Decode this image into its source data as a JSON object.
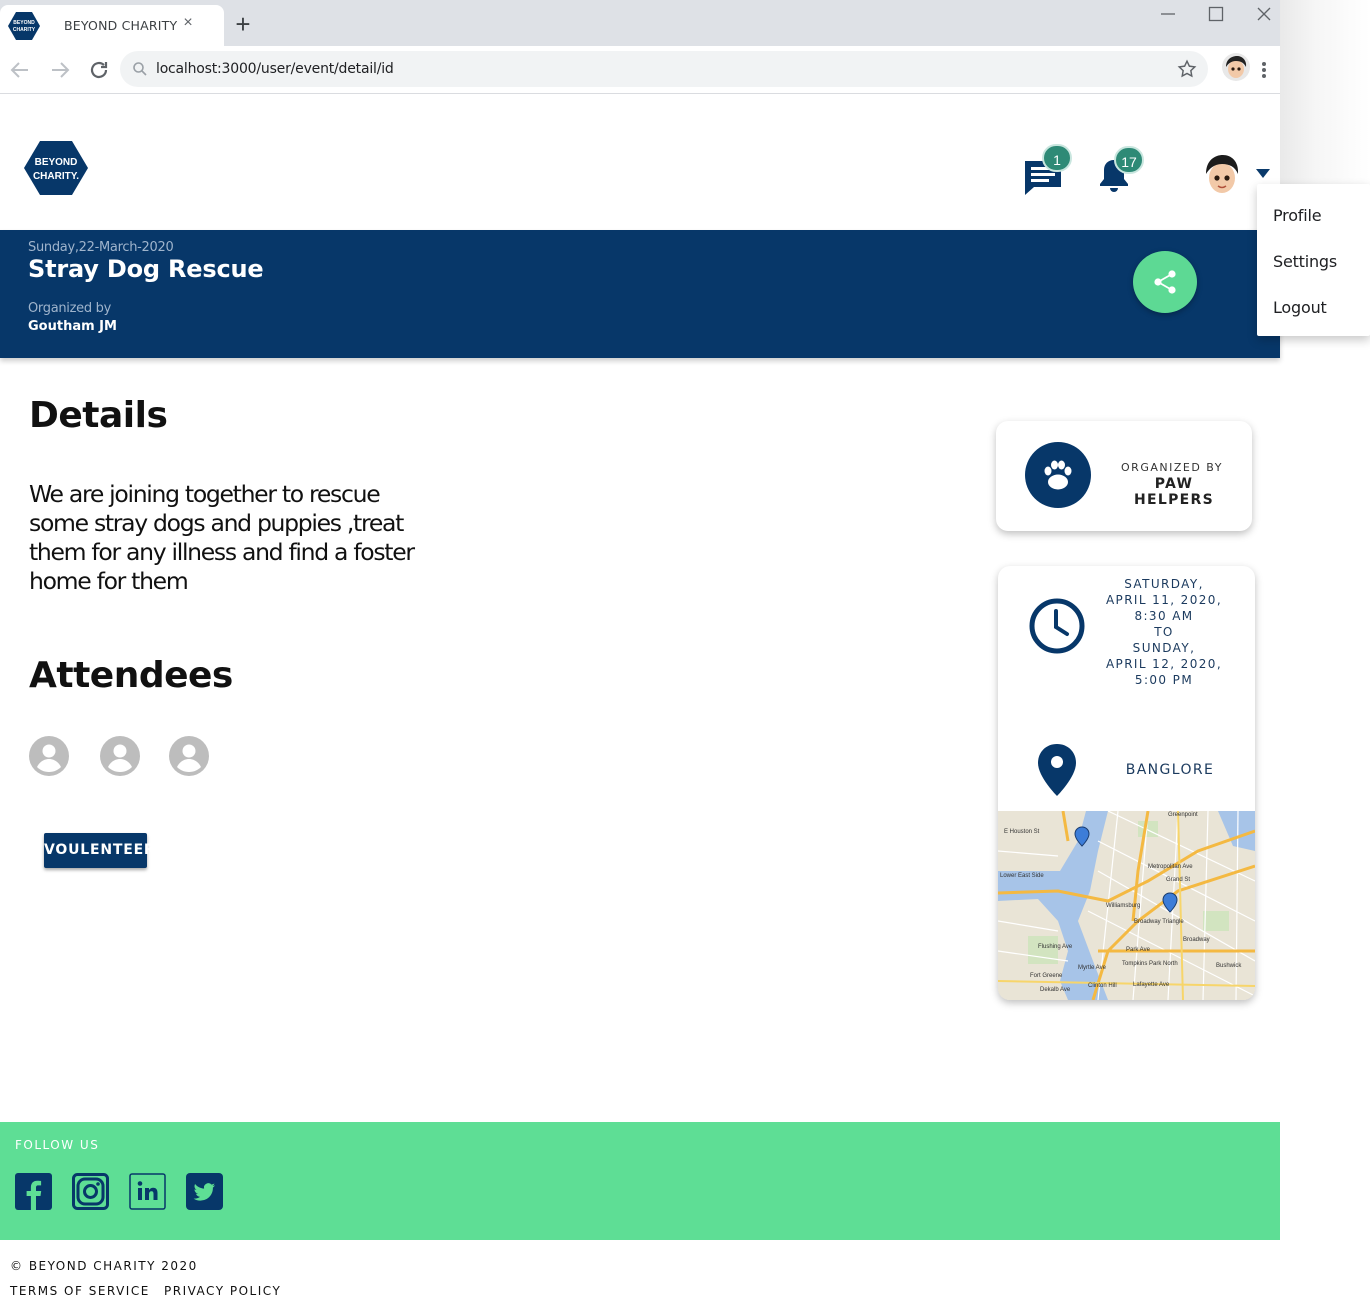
{
  "browser": {
    "tab_title": "BEYOND CHARITY",
    "tab_close": "×",
    "new_tab": "+",
    "url": "localhost:3000/user/event/detail/id",
    "favicon_text": [
      "BEYOND",
      "CHARITY"
    ]
  },
  "header": {
    "logo_text": [
      "BEYOND",
      "CHARITY."
    ],
    "messages_count": "1",
    "notifications_count": "17",
    "icons": [
      "chat-icon",
      "bell-icon",
      "avatar",
      "caret-down-icon"
    ]
  },
  "user_menu": {
    "items": [
      {
        "label": "Profile"
      },
      {
        "label": "Settings"
      },
      {
        "label": "Logout"
      }
    ]
  },
  "event": {
    "date": "Sunday,22-March-2020",
    "title": "Stray Dog Rescue",
    "organized_by_label": "Organized by",
    "organizer": "Goutham JM"
  },
  "main": {
    "details_heading": "Details",
    "details_text": "We are joining together to rescue some stray dogs and puppies ,treat them for any illness and find a foster home   for them",
    "attendees_heading": "Attendees",
    "attendee_count": 3,
    "volunteer_label": "VOULENTEER"
  },
  "org_card": {
    "label": "ORGANIZED BY",
    "name": "PAW HELPERS"
  },
  "info_card": {
    "date_lines": [
      "SATURDAY,",
      "APRIL 11, 2020,",
      "8:30 AM",
      "TO",
      "SUNDAY,",
      "APRIL 12, 2020,",
      "5:00 PM"
    ],
    "location": "BANGLORE",
    "map_labels": [
      "Greenpoint",
      "E Houston St",
      "Lower East Side",
      "Williamsburg",
      "Broadway Triangle",
      "Metropolitan Ave",
      "Grand St",
      "Flushing Ave",
      "Park Ave",
      "Myrtle Ave",
      "Tompkins Park North",
      "Fort Greene",
      "Clinton Hill",
      "Bushwick",
      "Dekalb Ave",
      "Lafayette Ave",
      "Broadway"
    ]
  },
  "footer": {
    "follow_label": "FOLLOW US",
    "social": [
      "facebook-icon",
      "instagram-icon",
      "linkedin-icon",
      "twitter-icon"
    ],
    "copyright": "© BEYOND CHARITY 2020",
    "terms": "TERMS OF SERVICE",
    "privacy": "PRIVACY POLICY"
  },
  "colors": {
    "brand_navy": "#073769",
    "accent_green": "#5dd994",
    "badge_green": "#2e8a76",
    "footer_green": "#5ede95"
  }
}
